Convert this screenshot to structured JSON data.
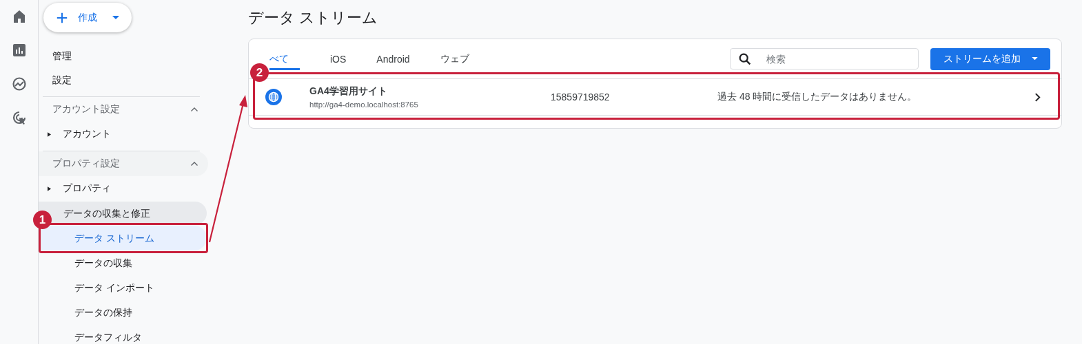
{
  "create_button": {
    "label": "作成"
  },
  "nav": [
    {
      "kind": "link",
      "label": "管理"
    },
    {
      "kind": "link",
      "label": "設定"
    },
    {
      "kind": "section",
      "label": "アカウント設定",
      "expanded": true,
      "active": false
    },
    {
      "kind": "node",
      "label": "アカウント",
      "expanded": false
    },
    {
      "kind": "section",
      "label": "プロパティ設定",
      "expanded": true,
      "active": true
    },
    {
      "kind": "node",
      "label": "プロパティ",
      "expanded": false
    },
    {
      "kind": "group",
      "label": "データの収集と修正",
      "active": true
    },
    {
      "kind": "subitem",
      "label": "データ ストリーム",
      "selected": true,
      "callout": "1"
    },
    {
      "kind": "subitem",
      "label": "データの収集",
      "selected": false
    },
    {
      "kind": "subitem",
      "label": "データ インポート",
      "selected": false
    },
    {
      "kind": "subitem",
      "label": "データの保持",
      "selected": false
    },
    {
      "kind": "subitem",
      "label": "データフィルタ",
      "selected": false
    }
  ],
  "page_title": "データ ストリーム",
  "tabs": [
    {
      "label": "べて",
      "selected": true
    },
    {
      "label": "iOS",
      "selected": false
    },
    {
      "label": "Android",
      "selected": false
    },
    {
      "label": "ウェブ",
      "selected": false
    }
  ],
  "search": {
    "placeholder": "検索"
  },
  "add_button": {
    "label": "ストリームを追加"
  },
  "streams": [
    {
      "name": "GA4学習用サイト",
      "url": "http://ga4-demo.localhost:8765",
      "id": "15859719852",
      "status": "過去 48 時間に受信したデータはありません。",
      "callout": "2"
    }
  ]
}
